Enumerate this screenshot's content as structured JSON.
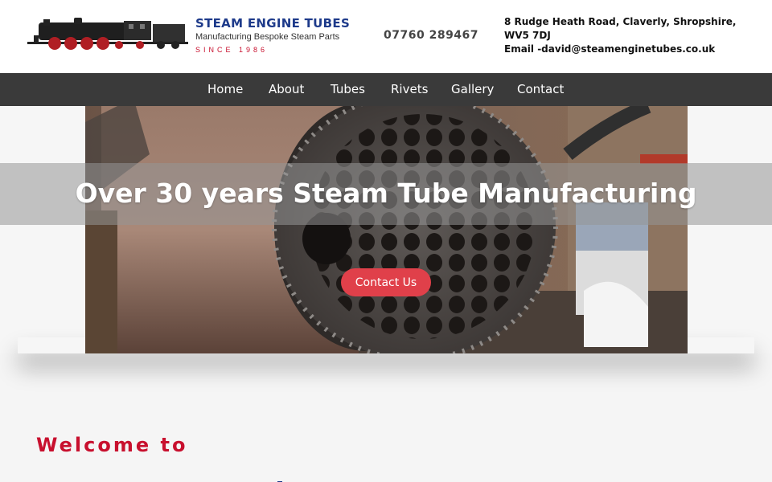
{
  "brand": {
    "title": "STEAM ENGINE TUBES",
    "subtitle": "Manufacturing Bespoke Steam Parts",
    "since": "SINCE 1986",
    "logo_icon": "steam-locomotive"
  },
  "contact": {
    "phone": "07760 289467",
    "address": "8 Rudge Heath Road, Claverly, Shropshire, WV5 7DJ",
    "email": "Email -david@steamenginetubes.co.uk"
  },
  "nav": {
    "items": [
      "Home",
      "About",
      "Tubes",
      "Rivets",
      "Gallery",
      "Contact"
    ]
  },
  "hero": {
    "title": "Over 30 years Steam Tube Manufacturing",
    "cta_label": "Contact Us"
  },
  "welcome": {
    "heading": "Welcome to"
  },
  "colors": {
    "brand_blue": "#1d3a8a",
    "accent_red": "#c8102e",
    "cta_red": "#e0404a",
    "nav_bg": "#3a3a3a"
  }
}
